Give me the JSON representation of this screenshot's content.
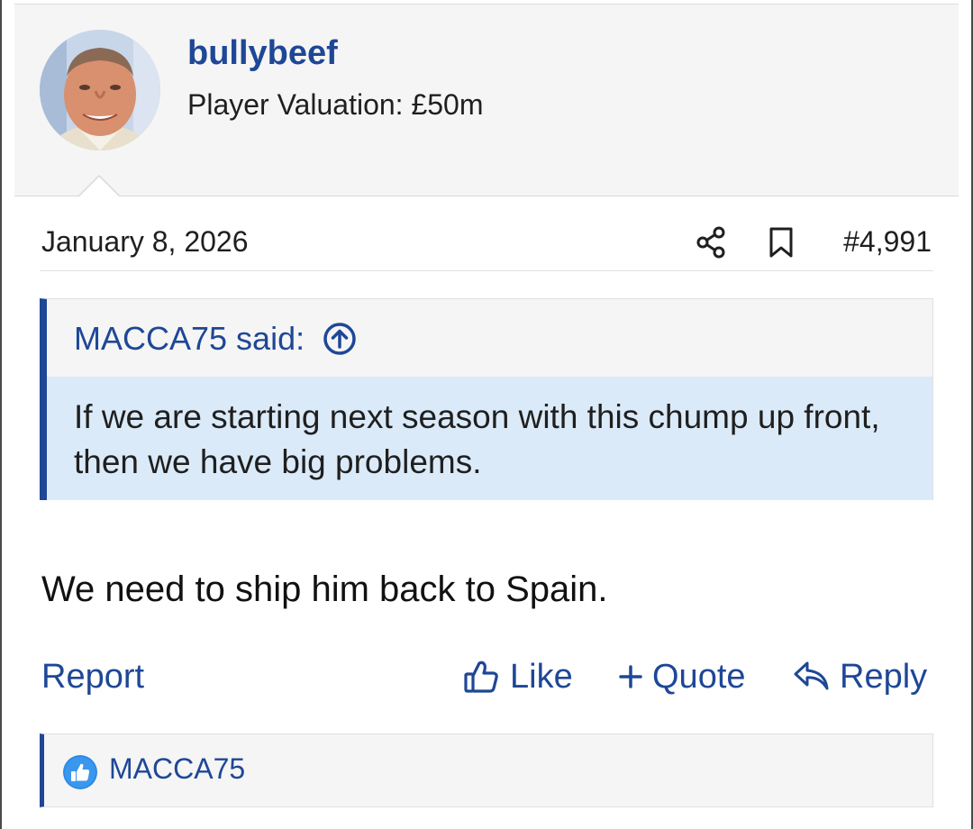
{
  "post": {
    "author": {
      "username": "bullybeef",
      "title": "Player Valuation: £50m",
      "avatar_icon": "user-avatar-photo"
    },
    "date": "January 8, 2026",
    "number": "#4,991",
    "quote": {
      "attribution": "MACCA75 said:",
      "text": "If we are starting next season with this chump up front, then we have big problems."
    },
    "body": "We need to ship him back to Spain.",
    "actions": {
      "report": "Report",
      "like": "Like",
      "quote": "Quote",
      "reply": "Reply"
    },
    "reactions": {
      "icon": "like-reaction-icon",
      "users": "MACCA75"
    }
  },
  "colors": {
    "link": "#1e4796",
    "quote_bg": "#dbeaf8",
    "panel_bg": "#f5f5f5",
    "reaction_blue": "#2d8ae6"
  }
}
